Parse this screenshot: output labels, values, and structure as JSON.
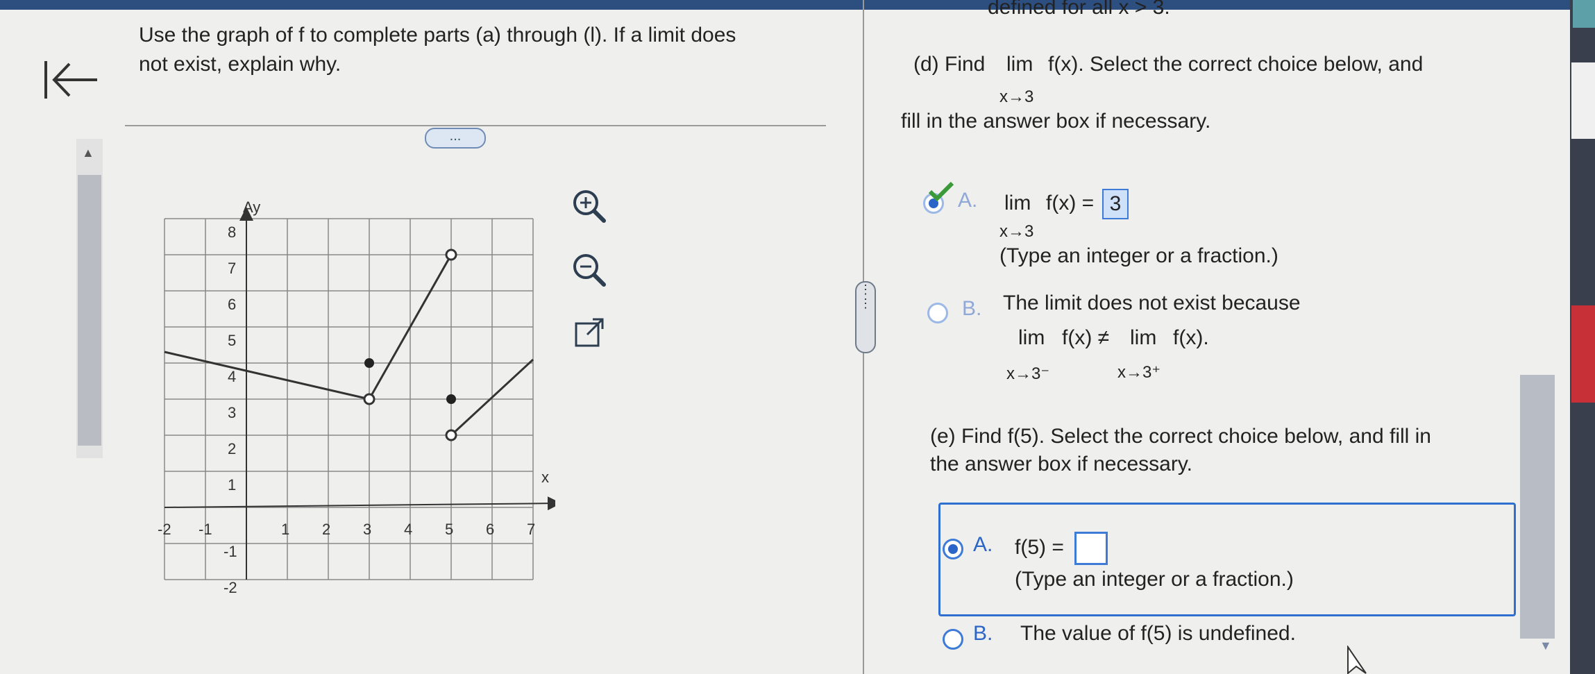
{
  "question": {
    "prompt_line1": "Use the graph of f to complete parts (a) through (l). If a limit does",
    "prompt_line2": "not exist, explain why.",
    "more_label": "...",
    "top_cut_text": "defined for all x > 3."
  },
  "graph": {
    "y_label": "Ay",
    "x_label": "x",
    "x_ticks": [
      "-2",
      "-1",
      "1",
      "2",
      "3",
      "4",
      "5",
      "6",
      "7"
    ],
    "y_ticks": [
      "8",
      "7",
      "6",
      "5",
      "4",
      "3",
      "2",
      "1",
      "-1",
      "-2"
    ]
  },
  "tools": {
    "zoom_in": "zoom-in",
    "zoom_out": "zoom-out",
    "popout": "open-in-new-window"
  },
  "part_d": {
    "intro": "(d) Find",
    "lim": "lim",
    "func": "f(x). Select the correct choice below, and",
    "sub": "x→3",
    "line2": "fill in the answer box if necessary.",
    "choice_a_label": "A.",
    "choice_a_lim": "lim",
    "choice_a_func": "f(x) =",
    "choice_a_value": "3",
    "choice_a_sub": "x→3",
    "choice_a_hint": "(Type an integer or a fraction.)",
    "choice_b_label": "B.",
    "choice_b_text": "The limit does not exist because",
    "choice_b_lim1": "lim",
    "choice_b_func1": "f(x) ≠",
    "choice_b_lim2": "lim",
    "choice_b_func2": "f(x).",
    "choice_b_sub1": "x→3⁻",
    "choice_b_sub2": "x→3⁺"
  },
  "part_e": {
    "line1": "(e) Find f(5). Select the correct choice below, and fill in",
    "line2": "the answer box if necessary.",
    "choice_a_label": "A.",
    "choice_a_text": "f(5) =",
    "choice_a_value": "",
    "choice_a_hint": "(Type an integer or a fraction.)",
    "choice_b_label": "B.",
    "choice_b_text": "The value of f(5) is undefined."
  },
  "colors": {
    "accent": "#2f6fd0",
    "correct_check": "#3a9a3a"
  }
}
